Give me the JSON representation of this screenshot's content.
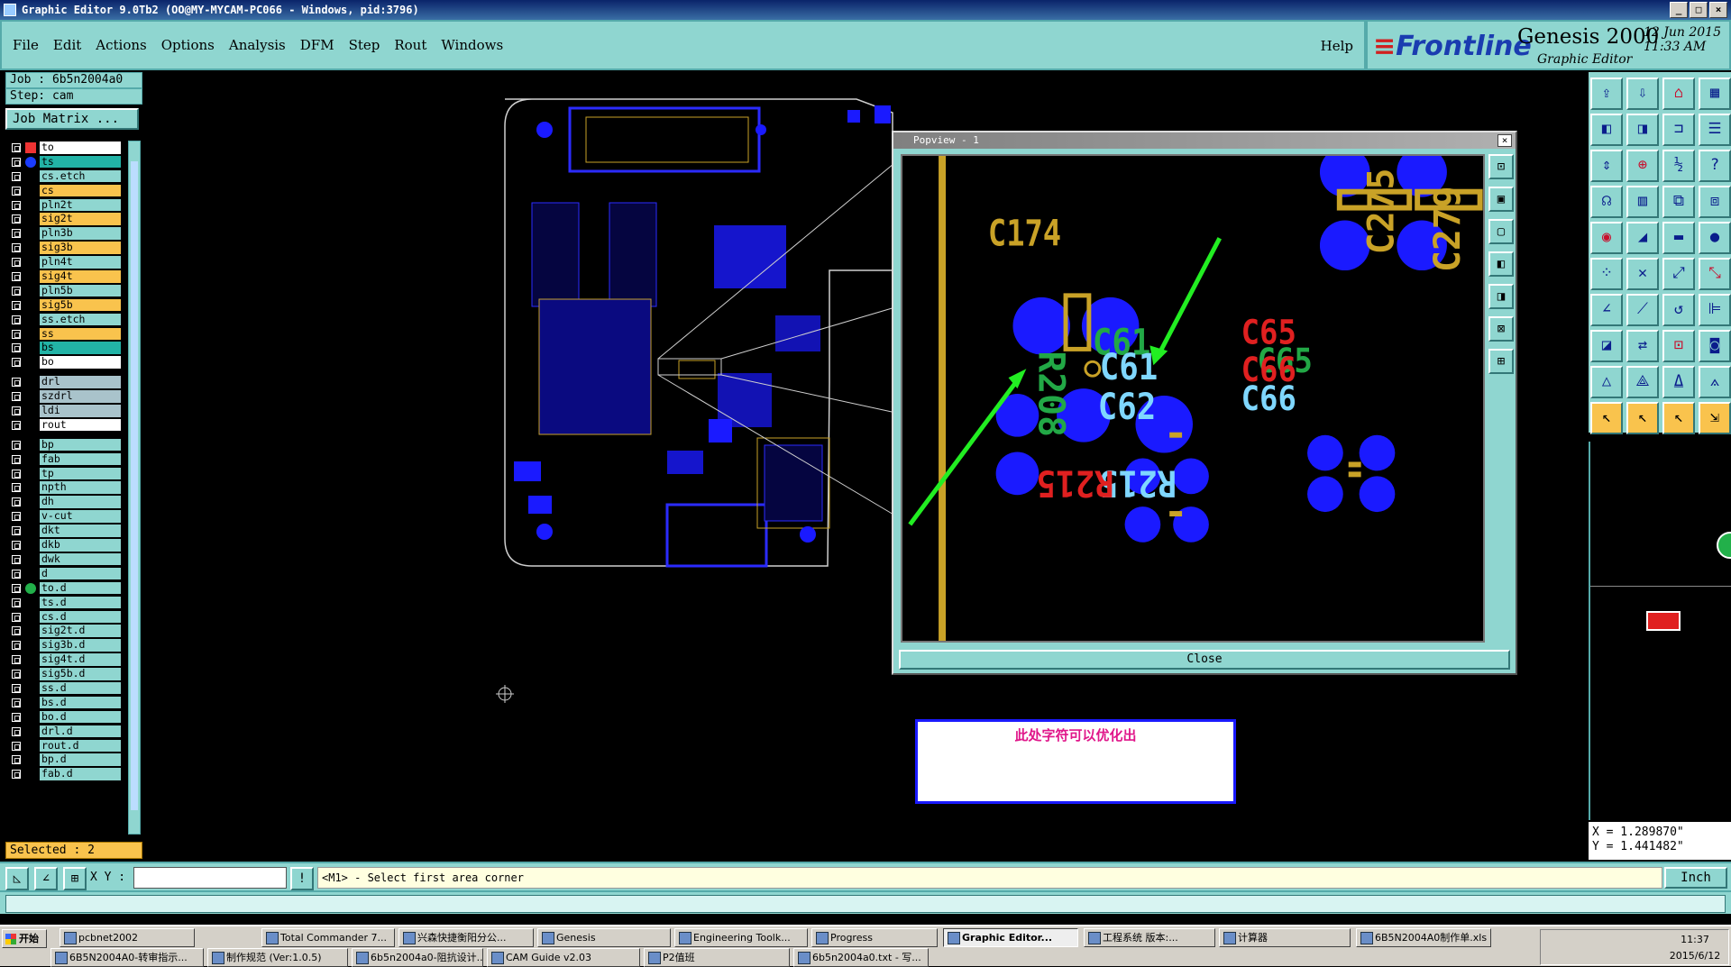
{
  "window": {
    "title": "Graphic Editor 9.0Tb2 (OO@MY-MYCAM-PC066 - Windows, pid:3796)",
    "controls": [
      "_",
      "□",
      "×"
    ]
  },
  "menu": [
    "File",
    "Edit",
    "Actions",
    "Options",
    "Analysis",
    "DFM",
    "Step",
    "Rout",
    "Windows"
  ],
  "help_label": "Help",
  "brand": {
    "logo": "Frontline",
    "product": "Genesis 2000",
    "subtitle": "Graphic Editor",
    "date": "12 Jun 2015",
    "time": "11:33 AM"
  },
  "job": {
    "label": "Job : 6b5n2004a0",
    "step": "Step: cam",
    "matrix_button": "Job Matrix ..."
  },
  "layers": [
    {
      "name": "to",
      "color": "white",
      "marker": "cursor"
    },
    {
      "name": "ts",
      "color": "teal",
      "marker": "blue"
    },
    {
      "name": "cs.etch",
      "color": "cyan"
    },
    {
      "name": "cs",
      "color": "yellow"
    },
    {
      "name": "pln2t",
      "color": "cyan"
    },
    {
      "name": "sig2t",
      "color": "yellow"
    },
    {
      "name": "pln3b",
      "color": "cyan"
    },
    {
      "name": "sig3b",
      "color": "yellow"
    },
    {
      "name": "pln4t",
      "color": "cyan"
    },
    {
      "name": "sig4t",
      "color": "yellow"
    },
    {
      "name": "pln5b",
      "color": "cyan"
    },
    {
      "name": "sig5b",
      "color": "yellow"
    },
    {
      "name": "ss.etch",
      "color": "cyan"
    },
    {
      "name": "ss",
      "color": "yellow"
    },
    {
      "name": "bs",
      "color": "teal"
    },
    {
      "name": "bo",
      "color": "white"
    },
    {
      "gap": true
    },
    {
      "name": "drl",
      "color": "gray"
    },
    {
      "name": "szdrl",
      "color": "gray"
    },
    {
      "name": "ldi",
      "color": "gray"
    },
    {
      "name": "rout",
      "color": "white"
    },
    {
      "gap": true
    },
    {
      "name": "bp",
      "color": "cyan"
    },
    {
      "name": "fab",
      "color": "cyan"
    },
    {
      "name": "tp",
      "color": "cyan"
    },
    {
      "name": "npth",
      "color": "cyan"
    },
    {
      "name": "dh",
      "color": "cyan"
    },
    {
      "name": "v-cut",
      "color": "cyan"
    },
    {
      "name": "dkt",
      "color": "cyan"
    },
    {
      "name": "dkb",
      "color": "cyan"
    },
    {
      "name": "dwk",
      "color": "cyan"
    },
    {
      "name": "d",
      "color": "cyan"
    },
    {
      "name": "to.d",
      "color": "cyan",
      "marker": "green"
    },
    {
      "name": "ts.d",
      "color": "cyan"
    },
    {
      "name": "cs.d",
      "color": "cyan"
    },
    {
      "name": "sig2t.d",
      "color": "cyan"
    },
    {
      "name": "sig3b.d",
      "color": "cyan"
    },
    {
      "name": "sig4t.d",
      "color": "cyan"
    },
    {
      "name": "sig5b.d",
      "color": "cyan"
    },
    {
      "name": "ss.d",
      "color": "cyan"
    },
    {
      "name": "bs.d",
      "color": "cyan"
    },
    {
      "name": "bo.d",
      "color": "cyan"
    },
    {
      "name": "drl.d",
      "color": "cyan"
    },
    {
      "name": "rout.d",
      "color": "cyan"
    },
    {
      "name": "bp.d",
      "color": "cyan"
    },
    {
      "name": "fab.d",
      "color": "cyan"
    }
  ],
  "selected": "Selected : 2",
  "popview": {
    "title": "Popview - 1",
    "close_button": "Close",
    "refdes_yellow": [
      "C174",
      "C275",
      "C279"
    ],
    "refdes_red": [
      "C65",
      "C66",
      "R215"
    ],
    "refdes_green": [
      "C65",
      "C61",
      "R208"
    ],
    "refdes_blue": [
      "C61",
      "C62",
      "R215",
      "C66"
    ]
  },
  "annotation": "此处字符可以优化出",
  "coords": {
    "x": "X = 1.289870\"",
    "y": "Y = 1.441482\""
  },
  "command": {
    "xy_label": "X Y :",
    "input_value": "",
    "prompt": "<M1> - Select first area corner",
    "unit": "Inch"
  },
  "taskbar": {
    "start": "开始",
    "row1": [
      "pcbnet2002",
      "Total Commander 7...",
      "兴森快捷衡阳分公...",
      "Genesis",
      "Engineering Toolk...",
      "Progress",
      "Graphic Editor...",
      "工程系统  版本:...",
      "计算器",
      "6B5N2004A0制作单.xls"
    ],
    "row2": [
      "6B5N2004A0-转审指示...",
      "制作规范 (Ver:1.0.5)",
      "6b5n2004a0-阻抗设计...",
      "CAM Guide v2.03",
      "P2值班",
      "6b5n2004a0.txt - 写..."
    ],
    "active": "Graphic Editor...",
    "clock": "11:37",
    "date": "2015/6/12"
  },
  "colors": {
    "panel": "#8fd6d0",
    "copper": "#1a1aff",
    "silk_yellow": "#c9a227",
    "red": "#e02020",
    "green_arrow": "#22ee22"
  }
}
